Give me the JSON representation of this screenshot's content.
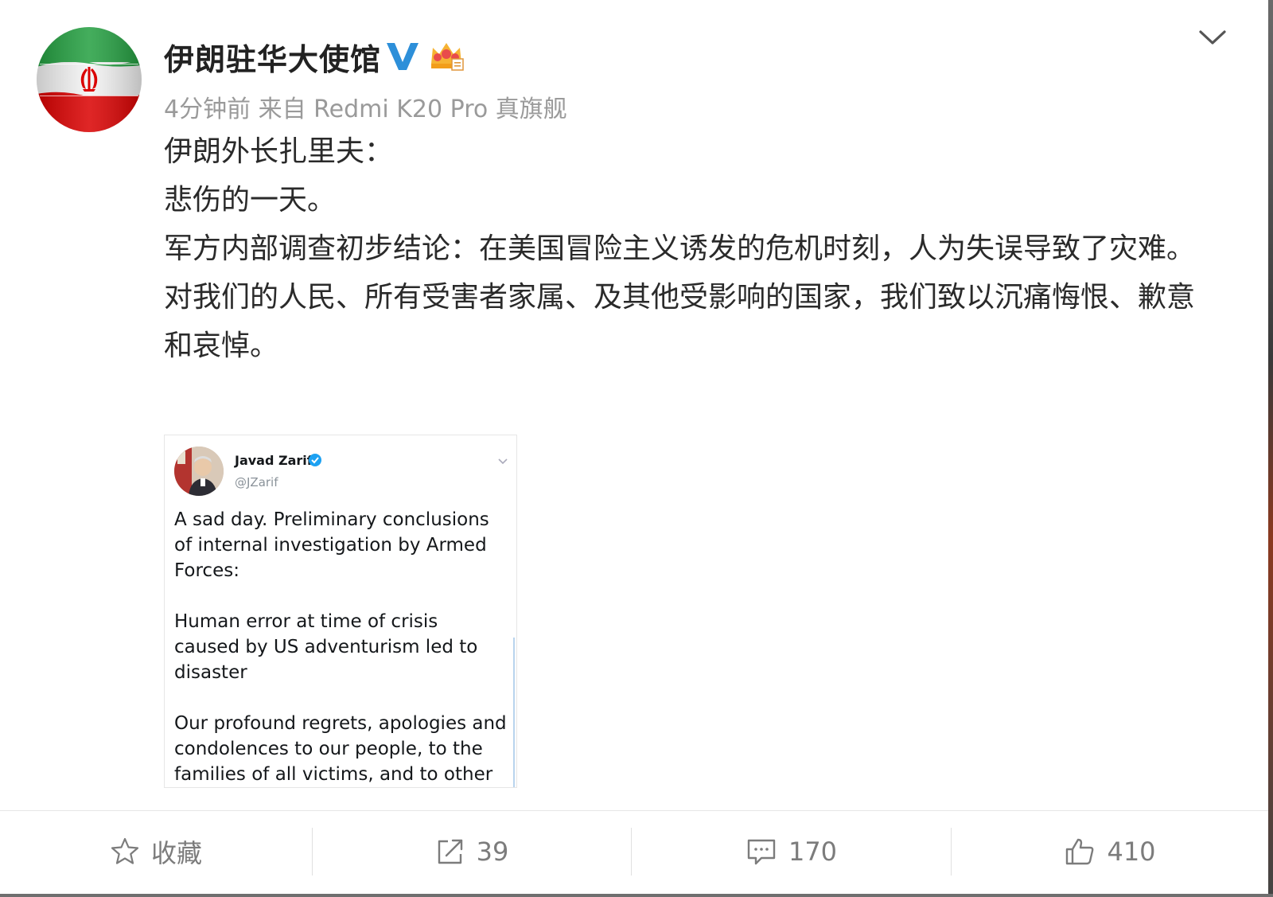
{
  "post": {
    "author": "伊朗驻华大使馆",
    "meta": "4分钟前 来自 Redmi K20 Pro 真旗舰",
    "paragraphs": [
      "伊朗外长扎里夫：",
      "悲伤的一天。",
      "军方内部调查初步结论：在美国冒险主义诱发的危机时刻，人为失误导致了灾难。",
      "对我们的人民、所有受害者家属、及其他受影响的国家，我们致以沉痛悔恨、歉意和哀悼。"
    ]
  },
  "tweet": {
    "name": "Javad Zarif",
    "handle": "@JZarif",
    "paragraphs": [
      "A sad day. Preliminary conclusions of internal investigation by Armed Forces:",
      "Human error at time of crisis caused by US adventurism led to disaster",
      "Our profound regrets, apologies and condolences to our people, to the families of all victims, and to other affected nations."
    ]
  },
  "actions": {
    "favorite_label": "收藏",
    "repost_count": "39",
    "comment_count": "170",
    "like_count": "410"
  },
  "colors": {
    "verified_blue": "#2d8fd9",
    "flag_green": "#239f40",
    "flag_red": "#da0000",
    "tweet_verified": "#1da1f2"
  },
  "icons": {
    "verified": "verified-v-icon",
    "crown": "crown-member-icon",
    "expand": "chevron-down-icon",
    "favorite": "star-icon",
    "repost": "share-arrow-icon",
    "comment": "comment-bubble-icon",
    "like": "thumbs-up-icon"
  }
}
